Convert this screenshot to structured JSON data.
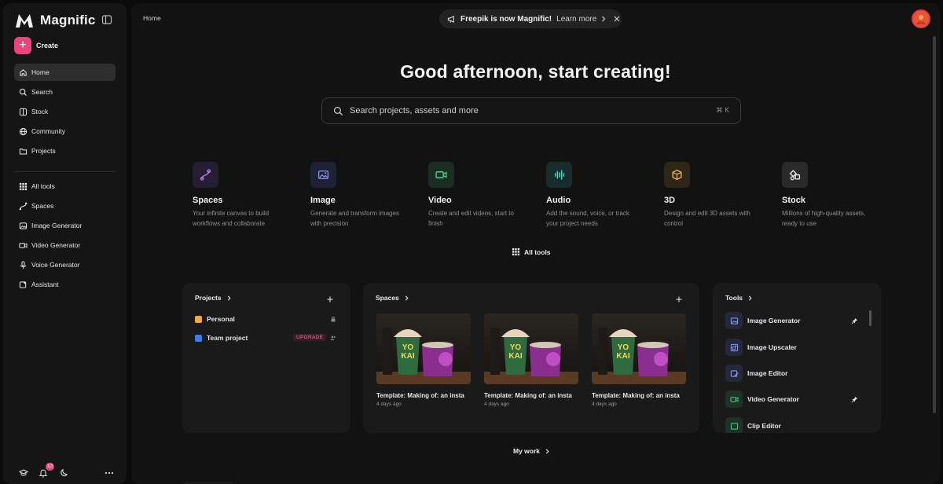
{
  "brand": {
    "name": "Magnific"
  },
  "sidebar": {
    "create_label": "Create",
    "primary": [
      {
        "label": "Home",
        "icon": "home-icon",
        "active": true
      },
      {
        "label": "Search",
        "icon": "search-icon"
      },
      {
        "label": "Stock",
        "icon": "stock-icon"
      },
      {
        "label": "Community",
        "icon": "globe-icon"
      },
      {
        "label": "Projects",
        "icon": "folder-icon"
      }
    ],
    "tools": [
      {
        "label": "All tools",
        "icon": "grid-icon"
      },
      {
        "label": "Spaces",
        "icon": "spaces-icon"
      },
      {
        "label": "Image Generator",
        "icon": "image-icon"
      },
      {
        "label": "Video Generator",
        "icon": "video-icon"
      },
      {
        "label": "Voice Generator",
        "icon": "mic-icon"
      },
      {
        "label": "Assistant",
        "icon": "assistant-icon"
      }
    ],
    "notification_count": "12"
  },
  "header": {
    "breadcrumb": "Home",
    "banner_text": "Freepik is now Magnific!",
    "banner_link": "Learn more"
  },
  "main": {
    "greeting": "Good afternoon, start creating!",
    "search_placeholder": "Search projects, assets and more",
    "search_shortcut": "⌘ K",
    "categories": [
      {
        "title": "Spaces",
        "desc": "Your infinite canvas to build workflows and collaborate",
        "icon": "spaces-icon",
        "color": "#b07ae8",
        "bg": "#241d33"
      },
      {
        "title": "Image",
        "desc": "Generate and transform images with precision",
        "icon": "image-icon",
        "color": "#7c8cf0",
        "bg": "#1e2237"
      },
      {
        "title": "Video",
        "desc": "Create and edit videos, start to finish",
        "icon": "video-icon",
        "color": "#4fcf8a",
        "bg": "#1b2e24"
      },
      {
        "title": "Audio",
        "desc": "Add the sound, voice, or track your project needs",
        "icon": "audio-icon",
        "color": "#4fd4c4",
        "bg": "#182c2b"
      },
      {
        "title": "3D",
        "desc": "Design and edit 3D assets with control",
        "icon": "cube-icon",
        "color": "#e6b04a",
        "bg": "#2e2616"
      },
      {
        "title": "Stock",
        "desc": "Millions of high-quality assets, ready to use",
        "icon": "stock-icon",
        "color": "#e9e9e9",
        "bg": "#2a2a2a"
      }
    ],
    "all_tools_label": "All tools",
    "my_work_label": "My work"
  },
  "projects_panel": {
    "title": "Projects",
    "items": [
      {
        "name": "Personal",
        "color": "#f2a74b"
      },
      {
        "name": "Team project",
        "color": "#3d7be8",
        "badge": "UPGRADE"
      }
    ]
  },
  "spaces_panel": {
    "title": "Spaces",
    "items": [
      {
        "title": "Template: Making of: an insta",
        "time": "4 days ago"
      },
      {
        "title": "Template: Making of: an insta",
        "time": "4 days ago"
      },
      {
        "title": "Template: Making of: an insta",
        "time": "4 days ago"
      }
    ]
  },
  "tools_panel": {
    "title": "Tools",
    "items": [
      {
        "name": "Image Generator",
        "pinned": true
      },
      {
        "name": "Image Upscaler",
        "pinned": false
      },
      {
        "name": "Image Editor",
        "pinned": false
      },
      {
        "name": "Video Generator",
        "pinned": true
      },
      {
        "name": "Clip Editor",
        "pinned": false
      }
    ]
  }
}
